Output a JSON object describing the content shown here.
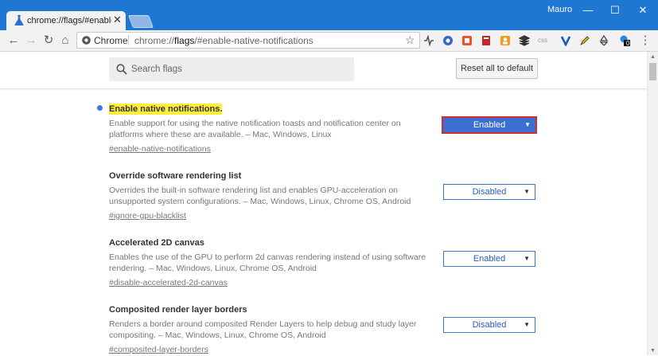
{
  "window": {
    "user_name": "Mauro",
    "minimize_glyph": "—",
    "maximize_glyph": "☐",
    "close_glyph": "✕"
  },
  "tab": {
    "title": "chrome://flags/#enable-n",
    "close_glyph": "✕",
    "favicon": "flask-icon"
  },
  "toolbar": {
    "back_glyph": "←",
    "forward_glyph": "→",
    "reload_glyph": "↻",
    "home_glyph": "⌂",
    "chip_label": "Chrome",
    "url_prefix": "chrome://",
    "url_host": "flags",
    "url_path": "/#enable-native-notifications",
    "star_glyph": "☆",
    "menu_glyph": "⋮",
    "extensions": [
      "extension-pulse-icon",
      "extension-circle-icon",
      "extension-app-icon",
      "extension-book-icon",
      "extension-person-icon",
      "extension-stack-icon",
      "extension-css-icon",
      "extension-v-icon",
      "extension-pencil-icon",
      "extension-recycle-icon",
      "extension-bell-badge-icon"
    ],
    "ext_badge": "0",
    "css_label": "css"
  },
  "search": {
    "placeholder": "Search flags",
    "reset_label": "Reset all to default"
  },
  "flags": [
    {
      "title": "Enable native notifications.",
      "description": "Enable support for using the native notification toasts and notification center on platforms where these are available. – Mac, Windows, Linux",
      "link": "#enable-native-notifications",
      "value": "Enabled"
    },
    {
      "title": "Override software rendering list",
      "description": "Overrides the built-in software rendering list and enables GPU-acceleration on unsupported system configurations. – Mac, Windows, Linux, Chrome OS, Android",
      "link": "#ignore-gpu-blacklist",
      "value": "Disabled"
    },
    {
      "title": "Accelerated 2D canvas",
      "description": "Enables the use of the GPU to perform 2d canvas rendering instead of using software rendering. – Mac, Windows, Linux, Chrome OS, Android",
      "link": "#disable-accelerated-2d-canvas",
      "value": "Enabled"
    },
    {
      "title": "Composited render layer borders",
      "description": "Renders a border around composited Render Layers to help debug and study layer compositing. – Mac, Windows, Linux, Chrome OS, Android",
      "link": "#composited-layer-borders",
      "value": "Disabled"
    }
  ],
  "colors": {
    "titlebar": "#1e77d2",
    "highlight": "#ffef3a",
    "active_select": "#3b6fd4",
    "focus_border": "#d42c2c"
  },
  "caret_glyph": "▼"
}
